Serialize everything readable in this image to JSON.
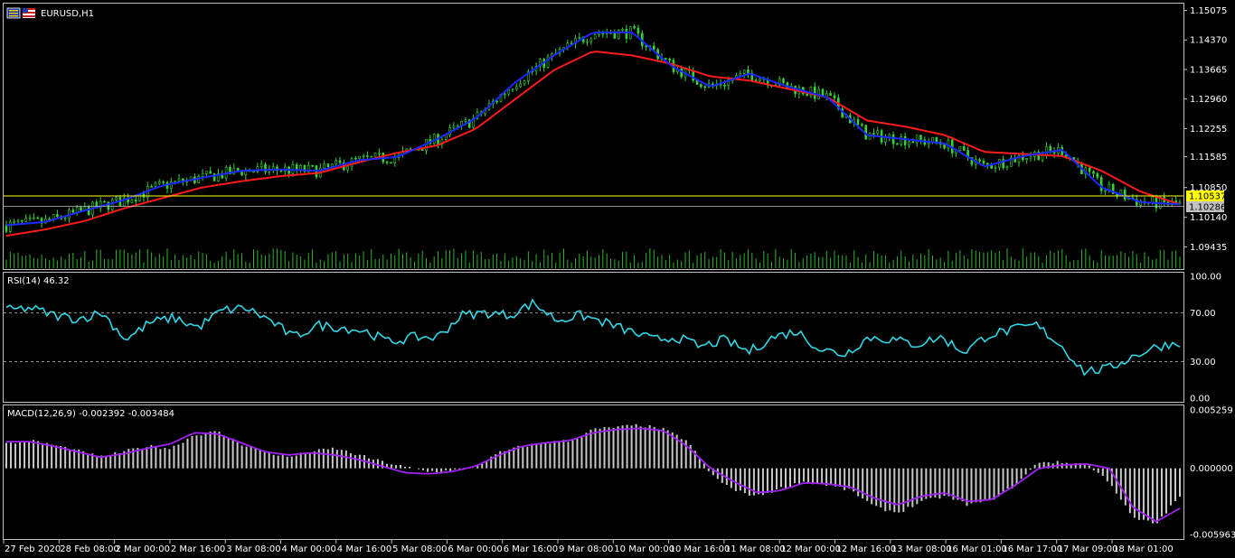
{
  "window": {
    "symbol_label": "EURUSD,H1"
  },
  "colors": {
    "background": "#000000",
    "border": "#c0c0c0",
    "text": "#ffffff",
    "candle": "#35d335",
    "volume": "#2fb52f",
    "ma_fast": "#1c28ff",
    "ma_slow": "#ff1a1a",
    "rsi": "#33d6e6",
    "macd_hist": "#c8c8c8",
    "macd_signal": "#a020f0",
    "bid_line": "#ffff00",
    "ask_line": "#c0c0c0",
    "bid_label_bg": "#ffff00",
    "ask_label_bg": "#c0c0c0"
  },
  "price_panel": {
    "ticks": [
      "1.15075",
      "1.14370",
      "1.13665",
      "1.12960",
      "1.12255",
      "1.11585",
      "1.10850",
      "1.10140",
      "1.09435"
    ],
    "bid_label": "1.10537",
    "ask_label": "1.10286"
  },
  "rsi_panel": {
    "label": "RSI(14) 46.32",
    "ticks": [
      "100.00",
      "70.00",
      "30.00",
      "0.00"
    ]
  },
  "macd_panel": {
    "label": "MACD(12,26,9) -0.002392 -0.003484",
    "ticks": [
      "0.005259",
      "0.000000",
      "-0.005963"
    ]
  },
  "time_axis": {
    "labels": [
      "27 Feb 2020",
      "28 Feb 08:00",
      "2 Mar 00:00",
      "2 Mar 16:00",
      "3 Mar 08:00",
      "4 Mar 00:00",
      "4 Mar 16:00",
      "5 Mar 08:00",
      "6 Mar 00:00",
      "6 Mar 16:00",
      "9 Mar 08:00",
      "10 Mar 00:00",
      "10 Mar 16:00",
      "11 Mar 08:00",
      "12 Mar 00:00",
      "12 Mar 16:00",
      "13 Mar 08:00",
      "16 Mar 01:00",
      "16 Mar 17:00",
      "17 Mar 09:00",
      "18 Mar 01:00"
    ]
  },
  "chart_data": [
    {
      "type": "line",
      "title": "EURUSD,H1",
      "ylim": [
        1.0925,
        1.1515
      ],
      "x_labels": [
        "27 Feb 2020",
        "28 Feb 08:00",
        "2 Mar 00:00",
        "2 Mar 16:00",
        "3 Mar 08:00",
        "4 Mar 00:00",
        "4 Mar 16:00",
        "5 Mar 08:00",
        "6 Mar 00:00",
        "6 Mar 16:00",
        "9 Mar 08:00",
        "10 Mar 00:00",
        "10 Mar 16:00",
        "11 Mar 08:00",
        "12 Mar 00:00",
        "12 Mar 16:00",
        "13 Mar 08:00",
        "16 Mar 01:00",
        "16 Mar 17:00",
        "17 Mar 09:00",
        "18 Mar 01:00"
      ],
      "series": [
        {
          "values": [
            1.0995,
            1.1003,
            1.103,
            1.1055,
            1.109,
            1.1108,
            1.1125,
            1.1128,
            1.1125,
            1.115,
            1.1158,
            1.12,
            1.125,
            1.1335,
            1.14,
            1.1455,
            1.1455,
            1.1375,
            1.1325,
            1.1357,
            1.1325,
            1.13,
            1.121,
            1.12,
            1.119,
            1.1135,
            1.116,
            1.1175,
            1.1085,
            1.105,
            1.1045
          ]
        },
        {
          "values": [
            1.097,
            1.0985,
            1.1005,
            1.1035,
            1.106,
            1.1085,
            1.11,
            1.1112,
            1.112,
            1.1145,
            1.1168,
            1.1185,
            1.1225,
            1.1295,
            1.1365,
            1.141,
            1.14,
            1.138,
            1.135,
            1.134,
            1.132,
            1.13,
            1.1245,
            1.123,
            1.121,
            1.117,
            1.1165,
            1.116,
            1.1125,
            1.1075,
            1.1045
          ]
        }
      ]
    },
    {
      "type": "line",
      "title": "RSI(14) 46.32",
      "ylim": [
        0,
        100
      ],
      "levels": [
        70,
        30
      ],
      "series": [
        {
          "values": [
            72,
            74,
            68,
            65,
            70,
            48,
            62,
            66,
            58,
            72,
            74,
            64,
            50,
            60,
            58,
            55,
            46,
            50,
            50,
            68,
            70,
            68,
            78,
            64,
            68,
            62,
            55,
            48,
            50,
            42,
            48,
            38,
            50,
            55,
            40,
            36,
            50,
            48,
            44,
            50,
            38,
            52,
            56,
            60,
            44,
            22,
            24,
            34,
            42,
            46
          ]
        }
      ]
    },
    {
      "type": "bar",
      "title": "MACD(12,26,9) -0.002392 -0.003484",
      "ylim": [
        -0.005963,
        0.005259
      ],
      "series": [
        {
          "values": [
            0.0022,
            0.0025,
            0.0021,
            0.0016,
            0.001,
            0.0015,
            0.002,
            0.0018,
            0.003,
            0.0033,
            0.0022,
            0.0015,
            0.001,
            0.0015,
            0.0018,
            0.0012,
            0.0006,
            0.0001,
            -0.0003,
            -0.0002,
            0.0001,
            0.0014,
            0.002,
            0.0023,
            0.0025,
            0.0035,
            0.0037,
            0.0039,
            0.0035,
            0.0025,
            -0.0005,
            -0.002,
            -0.0025,
            -0.0018,
            -0.0012,
            -0.0015,
            -0.002,
            -0.0035,
            -0.004,
            -0.003,
            -0.0025,
            -0.0033,
            -0.0028,
            -0.0015,
            0.0006,
            0.0005,
            0.0004,
            -0.0012,
            -0.0045,
            -0.005,
            -0.0025
          ]
        },
        {
          "values": [
            0.0024,
            0.0024,
            0.002,
            0.0015,
            0.001,
            0.0013,
            0.0018,
            0.0022,
            0.0032,
            0.0031,
            0.0023,
            0.0015,
            0.0012,
            0.0014,
            0.0012,
            0.0008,
            0.0002,
            -0.0004,
            -0.0005,
            -0.0003,
            0.0002,
            0.0012,
            0.002,
            0.0023,
            0.0025,
            0.0032,
            0.0035,
            0.0036,
            0.0034,
            0.002,
            0.0,
            -0.0012,
            -0.0022,
            -0.002,
            -0.0013,
            -0.0014,
            -0.0017,
            -0.0027,
            -0.0033,
            -0.0025,
            -0.0022,
            -0.003,
            -0.0028,
            -0.0015,
            0.0,
            0.0003,
            0.0004,
            0.0,
            -0.0035,
            -0.0048,
            -0.0036
          ]
        }
      ]
    }
  ]
}
